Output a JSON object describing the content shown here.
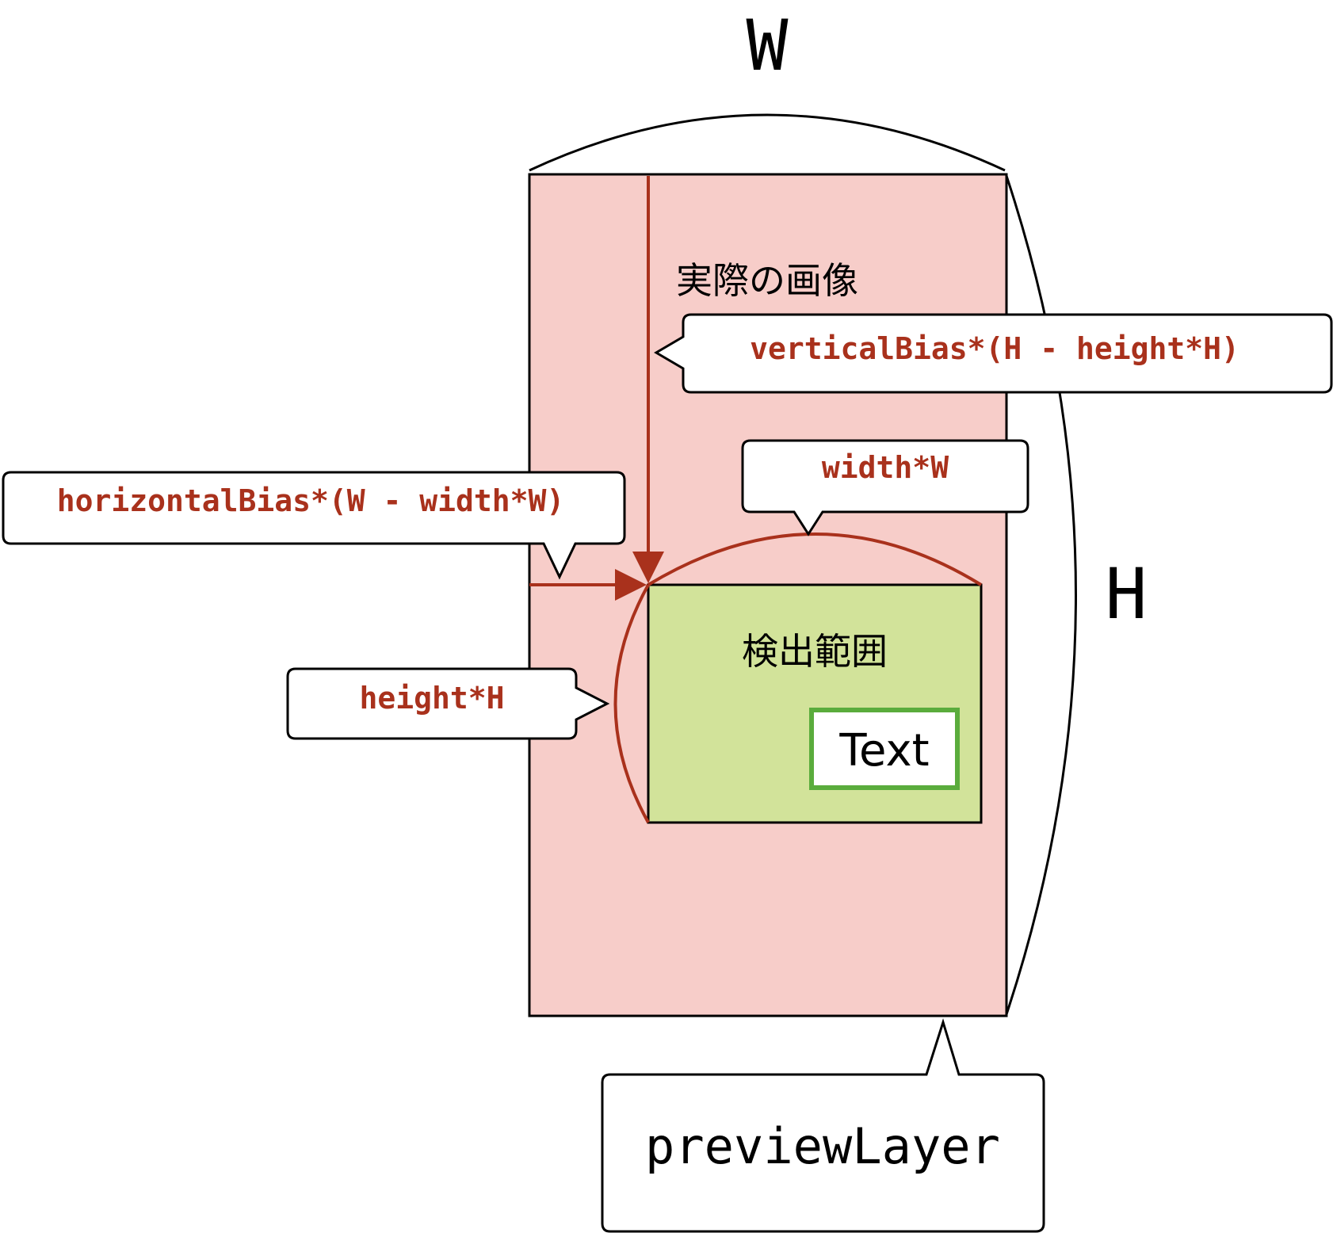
{
  "labels": {
    "W": "W",
    "H": "H",
    "actual_image": "実際の画像",
    "detection_area": "検出範囲",
    "text_box": "Text",
    "preview_layer": "previewLayer"
  },
  "callouts": {
    "vertical_bias": "verticalBias*(H - height*H)",
    "width": "width*W",
    "horizontal_bias": "horizontalBias*(W - width*W)",
    "height": "height*H"
  },
  "colors": {
    "image_fill": "#f7cdc9",
    "detection_fill": "#d2e39a",
    "accent_red": "#a9311c",
    "text_box_border": "#5aac3c",
    "outline": "#000000"
  }
}
